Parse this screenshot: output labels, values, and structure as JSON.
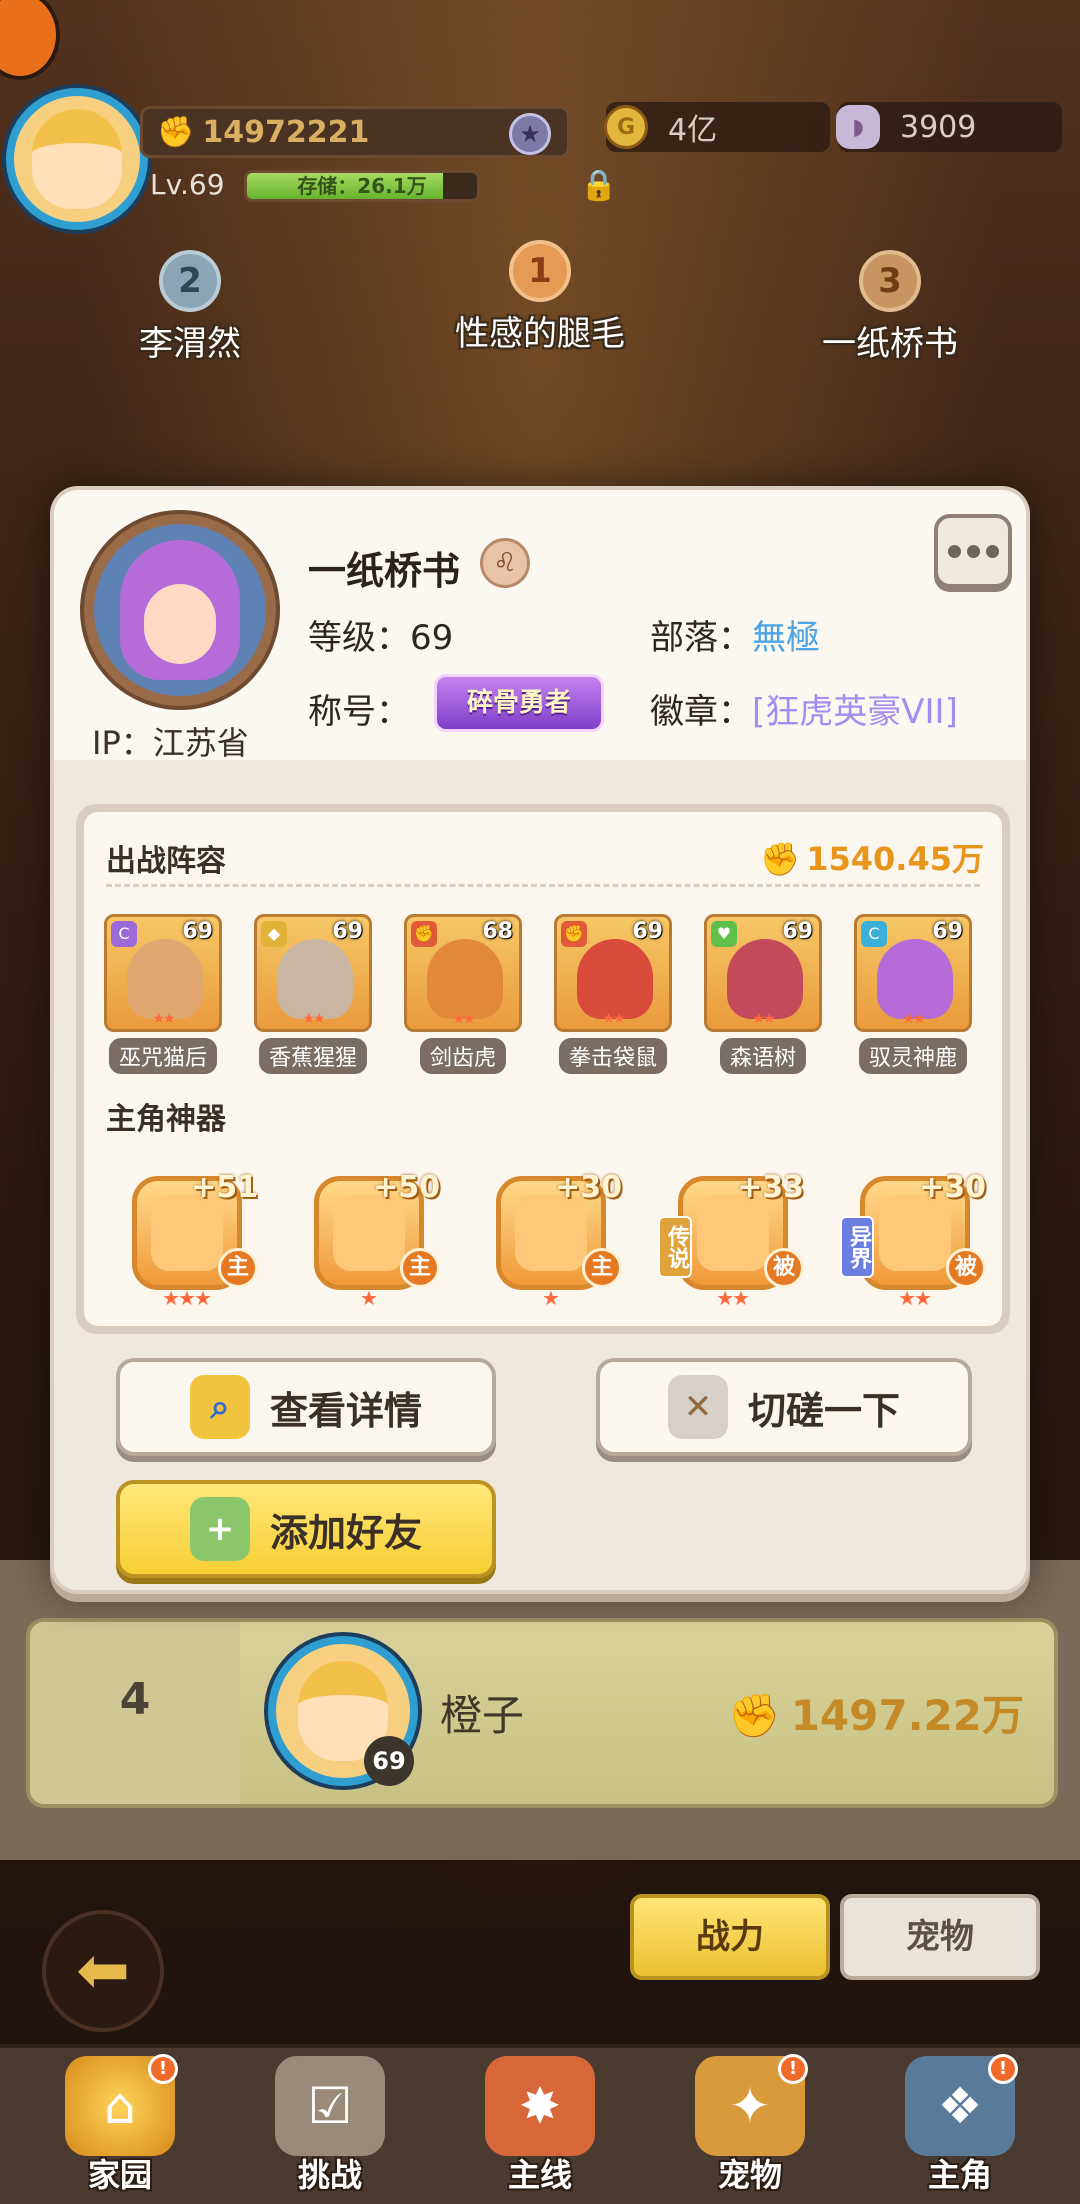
{
  "top": {
    "power": "14972221",
    "level": "Lv.69",
    "storage": "存储：26.1万",
    "storage_fill": 0.85,
    "gold": "4亿",
    "gems": "3909"
  },
  "podium": [
    {
      "rank": "2",
      "name": "李渭然"
    },
    {
      "rank": "1",
      "name": "性感的腿毛"
    },
    {
      "rank": "3",
      "name": "一纸桥书"
    }
  ],
  "profile": {
    "name": "一纸桥书",
    "ip": "IP：江苏省",
    "level_label": "等级：",
    "level_value": "69",
    "tribe_label": "部落：",
    "tribe_value": "無極",
    "title_label": "称号：",
    "title_badge": "碎骨勇者",
    "medal_label": "徽章：",
    "medal_value": "[狂虎英豪VII]"
  },
  "team": {
    "section_title": "出战阵容",
    "power": "1540.45万",
    "heroes": [
      {
        "name": "巫咒猫后",
        "level": "69",
        "type": "C",
        "type_color": "#9b6ad8",
        "color": "#e0a770"
      },
      {
        "name": "香蕉猩猩",
        "level": "69",
        "type": "◆",
        "type_color": "#e0b23a",
        "color": "#c9b6a2"
      },
      {
        "name": "剑齿虎",
        "level": "68",
        "type": "✊",
        "type_color": "#e05a3a",
        "color": "#e08a3a"
      },
      {
        "name": "拳击袋鼠",
        "level": "69",
        "type": "✊",
        "type_color": "#e05a3a",
        "color": "#d84a3a"
      },
      {
        "name": "森语树",
        "level": "69",
        "type": "♥",
        "type_color": "#5fbf4a",
        "color": "#c24a5a"
      },
      {
        "name": "驭灵神鹿",
        "level": "69",
        "type": "C",
        "type_color": "#3ab0d8",
        "color": "#b56bd8"
      }
    ],
    "artifact_title": "主角神器",
    "artifacts": [
      {
        "plus": "+51",
        "role": "主",
        "stars": "★★★",
        "tag": ""
      },
      {
        "plus": "+50",
        "role": "主",
        "stars": "★",
        "tag": ""
      },
      {
        "plus": "+30",
        "role": "主",
        "stars": "★",
        "tag": ""
      },
      {
        "plus": "+33",
        "role": "被",
        "stars": "★★",
        "tag": "传说"
      },
      {
        "plus": "+30",
        "role": "被",
        "stars": "★★",
        "tag": "异界"
      }
    ]
  },
  "buttons": {
    "details": "查看详情",
    "spar": "切磋一下",
    "add_friend": "添加好友"
  },
  "ranking_row": {
    "rank": "4",
    "name": "橙子",
    "level": "69",
    "power": "1497.22万"
  },
  "tabs": {
    "power": "战力",
    "pet": "宠物"
  },
  "nav": [
    {
      "label": "家园",
      "icon": "home-icon",
      "badge": "!"
    },
    {
      "label": "挑战",
      "icon": "challenge-icon",
      "badge": ""
    },
    {
      "label": "主线",
      "icon": "mainline-icon",
      "badge": ""
    },
    {
      "label": "宠物",
      "icon": "pet-icon",
      "badge": "!"
    },
    {
      "label": "主角",
      "icon": "hero-icon",
      "badge": "!"
    }
  ]
}
